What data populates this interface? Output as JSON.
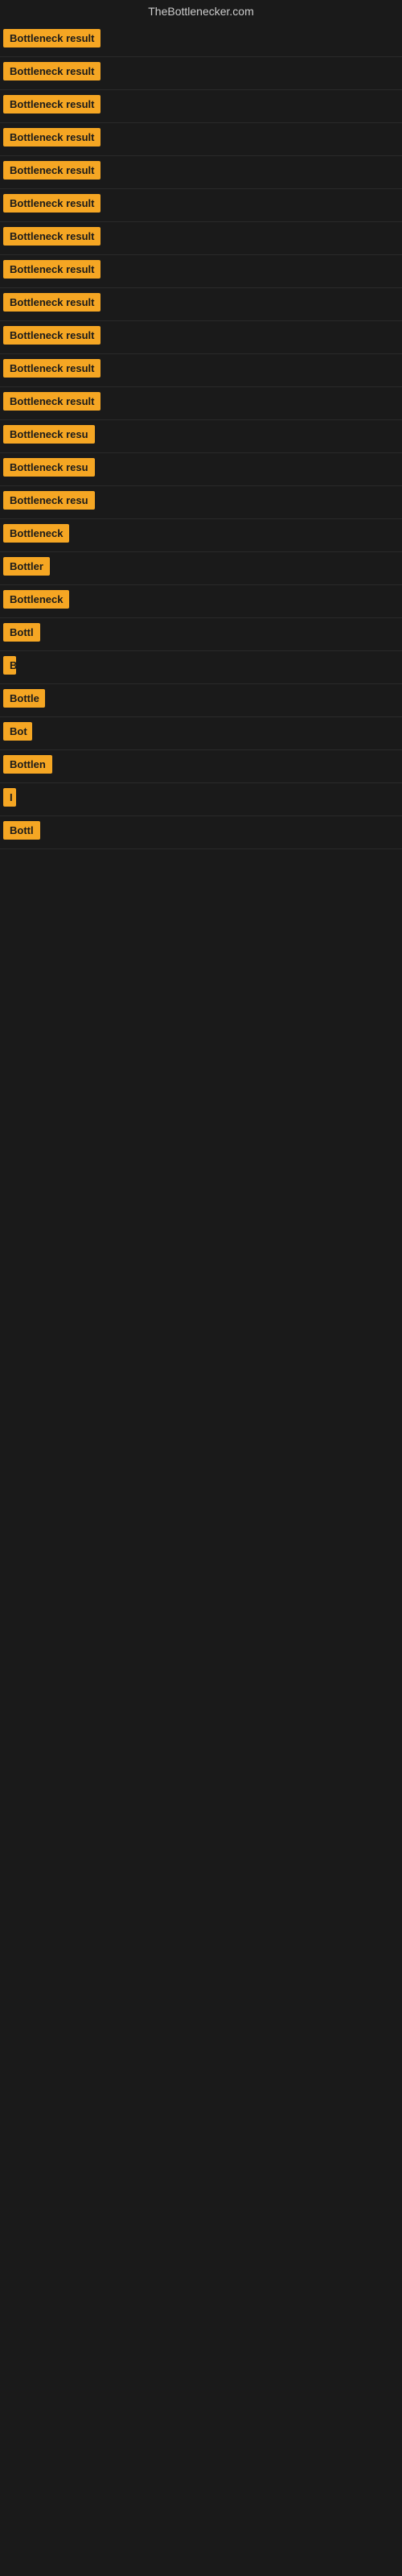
{
  "header": {
    "title": "TheBottlenecker.com"
  },
  "rows": [
    {
      "label": "Bottleneck result",
      "width": 140
    },
    {
      "label": "Bottleneck result",
      "width": 140
    },
    {
      "label": "Bottleneck result",
      "width": 140
    },
    {
      "label": "Bottleneck result",
      "width": 140
    },
    {
      "label": "Bottleneck result",
      "width": 140
    },
    {
      "label": "Bottleneck result",
      "width": 140
    },
    {
      "label": "Bottleneck result",
      "width": 140
    },
    {
      "label": "Bottleneck result",
      "width": 140
    },
    {
      "label": "Bottleneck result",
      "width": 140
    },
    {
      "label": "Bottleneck result",
      "width": 140
    },
    {
      "label": "Bottleneck result",
      "width": 140
    },
    {
      "label": "Bottleneck result",
      "width": 130
    },
    {
      "label": "Bottleneck resu",
      "width": 118
    },
    {
      "label": "Bottleneck resu",
      "width": 118
    },
    {
      "label": "Bottleneck resu",
      "width": 118
    },
    {
      "label": "Bottleneck",
      "width": 88
    },
    {
      "label": "Bottler",
      "width": 58
    },
    {
      "label": "Bottleneck",
      "width": 86
    },
    {
      "label": "Bottl",
      "width": 48
    },
    {
      "label": "B",
      "width": 14
    },
    {
      "label": "Bottle",
      "width": 52
    },
    {
      "label": "Bot",
      "width": 36
    },
    {
      "label": "Bottlen",
      "width": 64
    },
    {
      "label": "I",
      "width": 8
    },
    {
      "label": "Bottl",
      "width": 46
    }
  ]
}
